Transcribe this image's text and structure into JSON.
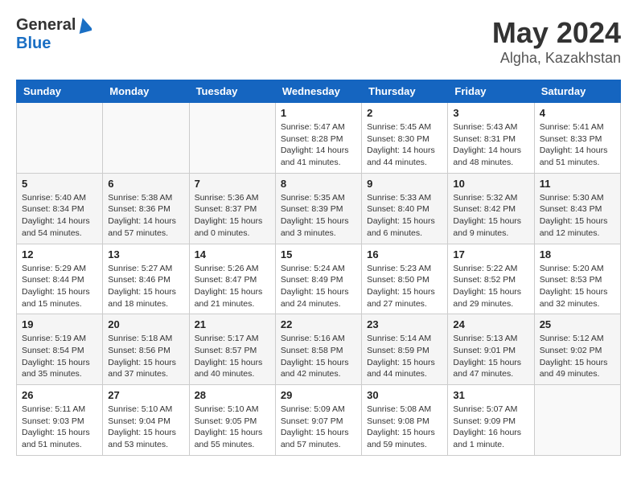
{
  "header": {
    "logo_general": "General",
    "logo_blue": "Blue",
    "month_year": "May 2024",
    "location": "Algha, Kazakhstan"
  },
  "days_of_week": [
    "Sunday",
    "Monday",
    "Tuesday",
    "Wednesday",
    "Thursday",
    "Friday",
    "Saturday"
  ],
  "weeks": [
    [
      {
        "day": "",
        "info": ""
      },
      {
        "day": "",
        "info": ""
      },
      {
        "day": "",
        "info": ""
      },
      {
        "day": "1",
        "info": "Sunrise: 5:47 AM\nSunset: 8:28 PM\nDaylight: 14 hours and 41 minutes."
      },
      {
        "day": "2",
        "info": "Sunrise: 5:45 AM\nSunset: 8:30 PM\nDaylight: 14 hours and 44 minutes."
      },
      {
        "day": "3",
        "info": "Sunrise: 5:43 AM\nSunset: 8:31 PM\nDaylight: 14 hours and 48 minutes."
      },
      {
        "day": "4",
        "info": "Sunrise: 5:41 AM\nSunset: 8:33 PM\nDaylight: 14 hours and 51 minutes."
      }
    ],
    [
      {
        "day": "5",
        "info": "Sunrise: 5:40 AM\nSunset: 8:34 PM\nDaylight: 14 hours and 54 minutes."
      },
      {
        "day": "6",
        "info": "Sunrise: 5:38 AM\nSunset: 8:36 PM\nDaylight: 14 hours and 57 minutes."
      },
      {
        "day": "7",
        "info": "Sunrise: 5:36 AM\nSunset: 8:37 PM\nDaylight: 15 hours and 0 minutes."
      },
      {
        "day": "8",
        "info": "Sunrise: 5:35 AM\nSunset: 8:39 PM\nDaylight: 15 hours and 3 minutes."
      },
      {
        "day": "9",
        "info": "Sunrise: 5:33 AM\nSunset: 8:40 PM\nDaylight: 15 hours and 6 minutes."
      },
      {
        "day": "10",
        "info": "Sunrise: 5:32 AM\nSunset: 8:42 PM\nDaylight: 15 hours and 9 minutes."
      },
      {
        "day": "11",
        "info": "Sunrise: 5:30 AM\nSunset: 8:43 PM\nDaylight: 15 hours and 12 minutes."
      }
    ],
    [
      {
        "day": "12",
        "info": "Sunrise: 5:29 AM\nSunset: 8:44 PM\nDaylight: 15 hours and 15 minutes."
      },
      {
        "day": "13",
        "info": "Sunrise: 5:27 AM\nSunset: 8:46 PM\nDaylight: 15 hours and 18 minutes."
      },
      {
        "day": "14",
        "info": "Sunrise: 5:26 AM\nSunset: 8:47 PM\nDaylight: 15 hours and 21 minutes."
      },
      {
        "day": "15",
        "info": "Sunrise: 5:24 AM\nSunset: 8:49 PM\nDaylight: 15 hours and 24 minutes."
      },
      {
        "day": "16",
        "info": "Sunrise: 5:23 AM\nSunset: 8:50 PM\nDaylight: 15 hours and 27 minutes."
      },
      {
        "day": "17",
        "info": "Sunrise: 5:22 AM\nSunset: 8:52 PM\nDaylight: 15 hours and 29 minutes."
      },
      {
        "day": "18",
        "info": "Sunrise: 5:20 AM\nSunset: 8:53 PM\nDaylight: 15 hours and 32 minutes."
      }
    ],
    [
      {
        "day": "19",
        "info": "Sunrise: 5:19 AM\nSunset: 8:54 PM\nDaylight: 15 hours and 35 minutes."
      },
      {
        "day": "20",
        "info": "Sunrise: 5:18 AM\nSunset: 8:56 PM\nDaylight: 15 hours and 37 minutes."
      },
      {
        "day": "21",
        "info": "Sunrise: 5:17 AM\nSunset: 8:57 PM\nDaylight: 15 hours and 40 minutes."
      },
      {
        "day": "22",
        "info": "Sunrise: 5:16 AM\nSunset: 8:58 PM\nDaylight: 15 hours and 42 minutes."
      },
      {
        "day": "23",
        "info": "Sunrise: 5:14 AM\nSunset: 8:59 PM\nDaylight: 15 hours and 44 minutes."
      },
      {
        "day": "24",
        "info": "Sunrise: 5:13 AM\nSunset: 9:01 PM\nDaylight: 15 hours and 47 minutes."
      },
      {
        "day": "25",
        "info": "Sunrise: 5:12 AM\nSunset: 9:02 PM\nDaylight: 15 hours and 49 minutes."
      }
    ],
    [
      {
        "day": "26",
        "info": "Sunrise: 5:11 AM\nSunset: 9:03 PM\nDaylight: 15 hours and 51 minutes."
      },
      {
        "day": "27",
        "info": "Sunrise: 5:10 AM\nSunset: 9:04 PM\nDaylight: 15 hours and 53 minutes."
      },
      {
        "day": "28",
        "info": "Sunrise: 5:10 AM\nSunset: 9:05 PM\nDaylight: 15 hours and 55 minutes."
      },
      {
        "day": "29",
        "info": "Sunrise: 5:09 AM\nSunset: 9:07 PM\nDaylight: 15 hours and 57 minutes."
      },
      {
        "day": "30",
        "info": "Sunrise: 5:08 AM\nSunset: 9:08 PM\nDaylight: 15 hours and 59 minutes."
      },
      {
        "day": "31",
        "info": "Sunrise: 5:07 AM\nSunset: 9:09 PM\nDaylight: 16 hours and 1 minute."
      },
      {
        "day": "",
        "info": ""
      }
    ]
  ]
}
